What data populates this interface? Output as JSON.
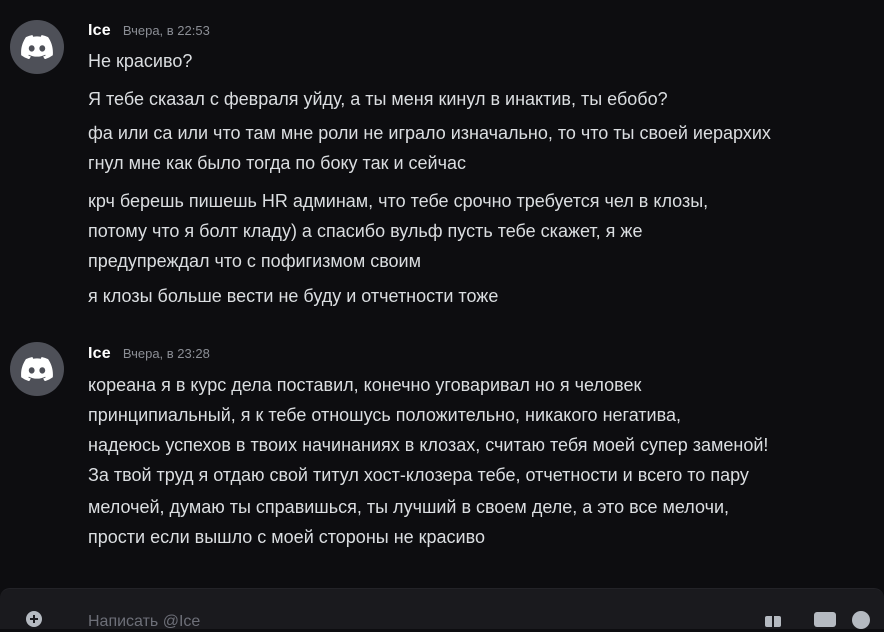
{
  "messages": [
    {
      "author": "Ice",
      "timestamp": "Вчера, в 22:53",
      "avatar_icon": "discord-logo-icon",
      "lines": [
        "Не красиво?",
        "Я тебе сказал с февраля уйду, а ты меня кинул в инактив, ты ебобо?",
        "фа или са или что там мне роли не играло изначально, то что ты своей иерархих",
        "гнул мне как было тогда по боку так и сейчас",
        "крч берешь пишешь HR админам, что тебе срочно требуется чел в клозы,",
        "потому что я болт кладу) а спасибо вульф пусть тебе скажет, я же",
        "предупреждал что с пофигизмом своим",
        "я клозы больше вести не буду и отчетности тоже"
      ]
    },
    {
      "author": "Ice",
      "timestamp": "Вчера, в 23:28",
      "avatar_icon": "discord-logo-icon",
      "lines": [
        "кореана я в курс дела поставил, конечно уговаривал но я человек",
        "принципиальный, я к тебе отношусь положительно, никакого негатива,",
        "надеюсь успехов в твоих начинаниях в клозах, считаю тебя моей супер заменой!",
        "За твой труд я отдаю свой титул хост-клозера тебе, отчетности и всего то пару",
        "мелочей, думаю ты справишься, ты лучший в своем деле, а это все мелочи,",
        "прости если вышло с моей стороны не красиво"
      ]
    }
  ],
  "composer": {
    "placeholder": "Написать @Ice",
    "icons": [
      "add-attachment-icon",
      "gift-icon",
      "gif-icon",
      "emoji-icon"
    ]
  },
  "colors": {
    "background": "#0d0d10",
    "text": "#dbdee1",
    "username": "#ffffff",
    "timestamp": "#8b8e95",
    "avatar_bg": "#4e5058"
  }
}
